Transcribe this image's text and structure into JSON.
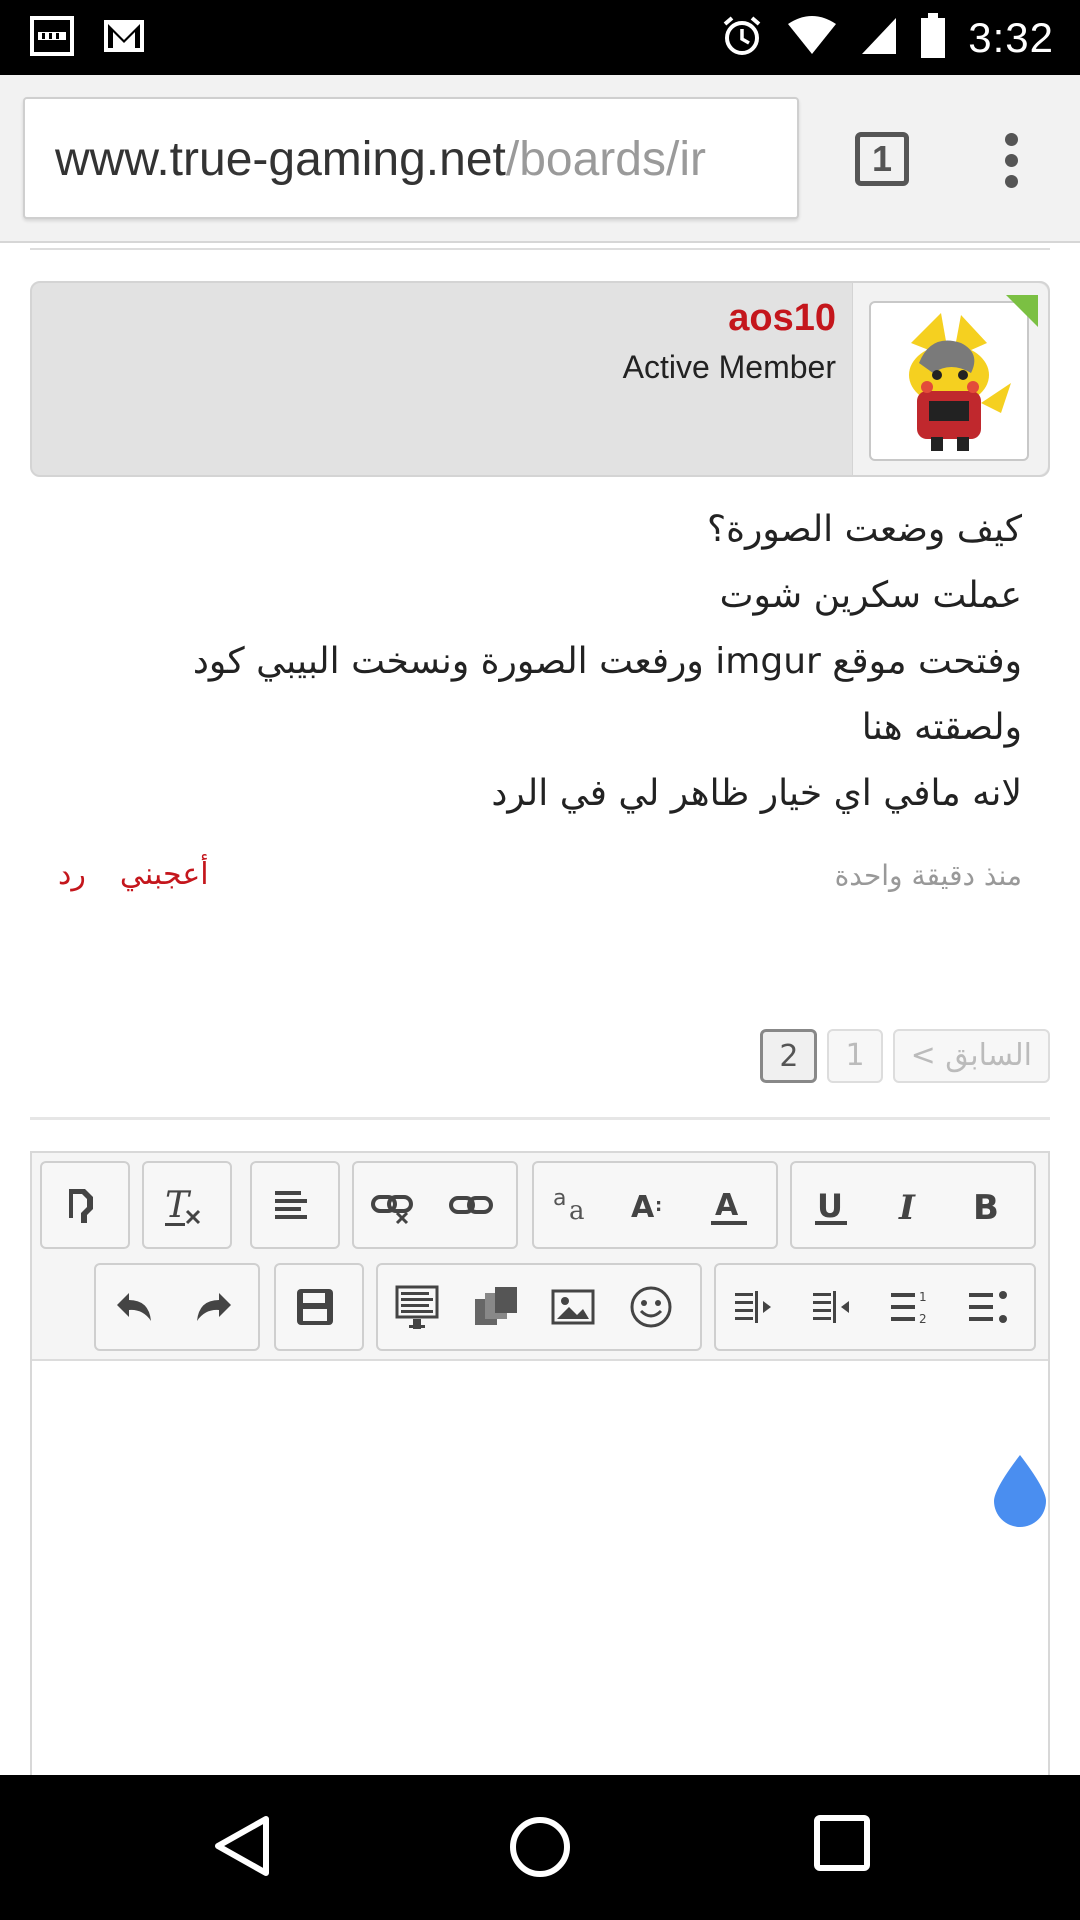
{
  "status_bar": {
    "time": "3:32",
    "icons": [
      "video-notification-icon",
      "gmail-icon",
      "alarm-icon",
      "wifi-icon",
      "cell-signal-icon",
      "battery-icon"
    ]
  },
  "browser": {
    "url_host": "www.true-gaming.net",
    "url_path": "/boards/ir",
    "tab_count": "1"
  },
  "post": {
    "username": "aos10",
    "user_title": "Active Member",
    "online": true,
    "lines": [
      "كيف وضعت الصورة؟",
      "عملت سكرين شوت",
      "وفتحت موقع imgur ورفعت الصورة ونسخت البيبي كود",
      "ولصقته هنا",
      "لانه مافي اي خيار ظاهر لي في الرد"
    ],
    "time_ago": "منذ دقيقة واحدة",
    "like_label": "أعجبني",
    "reply_label": "رد"
  },
  "pagination": {
    "prev_label": "< السابق",
    "pages": [
      "1",
      "2"
    ],
    "current": "2"
  },
  "editor_toolbar": {
    "row1": [
      "source-icon",
      "remove-format-icon",
      "align-icon",
      "unlink-icon",
      "link-icon",
      "font-icon",
      "font-size-icon",
      "font-color-icon",
      "underline-icon",
      "italic-icon",
      "bold-icon"
    ],
    "row2": [
      "undo-icon",
      "redo-icon",
      "save-icon",
      "quote-icon",
      "media-icon",
      "image-icon",
      "emoticon-icon",
      "indent-icon",
      "outdent-icon",
      "numbered-list-icon",
      "bullet-list-icon"
    ]
  },
  "colors": {
    "username": "#c4161c",
    "online": "#7bc043",
    "cursor_drop": "#4a8ef0"
  }
}
